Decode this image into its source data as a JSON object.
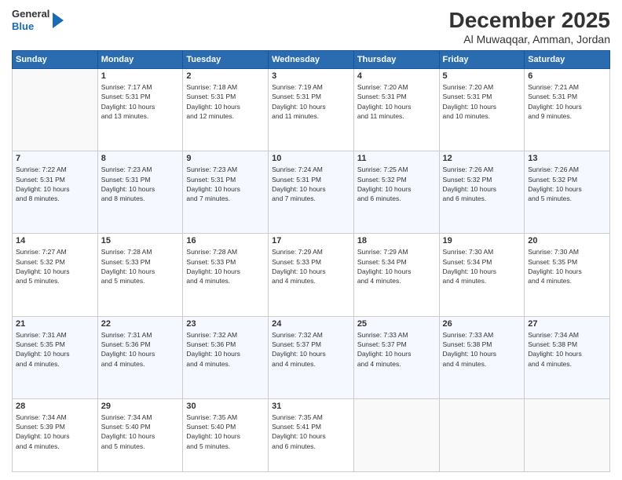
{
  "logo": {
    "general": "General",
    "blue": "Blue"
  },
  "title": "December 2025",
  "subtitle": "Al Muwaqqar, Amman, Jordan",
  "days_header": [
    "Sunday",
    "Monday",
    "Tuesday",
    "Wednesday",
    "Thursday",
    "Friday",
    "Saturday"
  ],
  "weeks": [
    [
      {
        "num": "",
        "info": ""
      },
      {
        "num": "1",
        "info": "Sunrise: 7:17 AM\nSunset: 5:31 PM\nDaylight: 10 hours\nand 13 minutes."
      },
      {
        "num": "2",
        "info": "Sunrise: 7:18 AM\nSunset: 5:31 PM\nDaylight: 10 hours\nand 12 minutes."
      },
      {
        "num": "3",
        "info": "Sunrise: 7:19 AM\nSunset: 5:31 PM\nDaylight: 10 hours\nand 11 minutes."
      },
      {
        "num": "4",
        "info": "Sunrise: 7:20 AM\nSunset: 5:31 PM\nDaylight: 10 hours\nand 11 minutes."
      },
      {
        "num": "5",
        "info": "Sunrise: 7:20 AM\nSunset: 5:31 PM\nDaylight: 10 hours\nand 10 minutes."
      },
      {
        "num": "6",
        "info": "Sunrise: 7:21 AM\nSunset: 5:31 PM\nDaylight: 10 hours\nand 9 minutes."
      }
    ],
    [
      {
        "num": "7",
        "info": "Sunrise: 7:22 AM\nSunset: 5:31 PM\nDaylight: 10 hours\nand 8 minutes."
      },
      {
        "num": "8",
        "info": "Sunrise: 7:23 AM\nSunset: 5:31 PM\nDaylight: 10 hours\nand 8 minutes."
      },
      {
        "num": "9",
        "info": "Sunrise: 7:23 AM\nSunset: 5:31 PM\nDaylight: 10 hours\nand 7 minutes."
      },
      {
        "num": "10",
        "info": "Sunrise: 7:24 AM\nSunset: 5:31 PM\nDaylight: 10 hours\nand 7 minutes."
      },
      {
        "num": "11",
        "info": "Sunrise: 7:25 AM\nSunset: 5:32 PM\nDaylight: 10 hours\nand 6 minutes."
      },
      {
        "num": "12",
        "info": "Sunrise: 7:26 AM\nSunset: 5:32 PM\nDaylight: 10 hours\nand 6 minutes."
      },
      {
        "num": "13",
        "info": "Sunrise: 7:26 AM\nSunset: 5:32 PM\nDaylight: 10 hours\nand 5 minutes."
      }
    ],
    [
      {
        "num": "14",
        "info": "Sunrise: 7:27 AM\nSunset: 5:32 PM\nDaylight: 10 hours\nand 5 minutes."
      },
      {
        "num": "15",
        "info": "Sunrise: 7:28 AM\nSunset: 5:33 PM\nDaylight: 10 hours\nand 5 minutes."
      },
      {
        "num": "16",
        "info": "Sunrise: 7:28 AM\nSunset: 5:33 PM\nDaylight: 10 hours\nand 4 minutes."
      },
      {
        "num": "17",
        "info": "Sunrise: 7:29 AM\nSunset: 5:33 PM\nDaylight: 10 hours\nand 4 minutes."
      },
      {
        "num": "18",
        "info": "Sunrise: 7:29 AM\nSunset: 5:34 PM\nDaylight: 10 hours\nand 4 minutes."
      },
      {
        "num": "19",
        "info": "Sunrise: 7:30 AM\nSunset: 5:34 PM\nDaylight: 10 hours\nand 4 minutes."
      },
      {
        "num": "20",
        "info": "Sunrise: 7:30 AM\nSunset: 5:35 PM\nDaylight: 10 hours\nand 4 minutes."
      }
    ],
    [
      {
        "num": "21",
        "info": "Sunrise: 7:31 AM\nSunset: 5:35 PM\nDaylight: 10 hours\nand 4 minutes."
      },
      {
        "num": "22",
        "info": "Sunrise: 7:31 AM\nSunset: 5:36 PM\nDaylight: 10 hours\nand 4 minutes."
      },
      {
        "num": "23",
        "info": "Sunrise: 7:32 AM\nSunset: 5:36 PM\nDaylight: 10 hours\nand 4 minutes."
      },
      {
        "num": "24",
        "info": "Sunrise: 7:32 AM\nSunset: 5:37 PM\nDaylight: 10 hours\nand 4 minutes."
      },
      {
        "num": "25",
        "info": "Sunrise: 7:33 AM\nSunset: 5:37 PM\nDaylight: 10 hours\nand 4 minutes."
      },
      {
        "num": "26",
        "info": "Sunrise: 7:33 AM\nSunset: 5:38 PM\nDaylight: 10 hours\nand 4 minutes."
      },
      {
        "num": "27",
        "info": "Sunrise: 7:34 AM\nSunset: 5:38 PM\nDaylight: 10 hours\nand 4 minutes."
      }
    ],
    [
      {
        "num": "28",
        "info": "Sunrise: 7:34 AM\nSunset: 5:39 PM\nDaylight: 10 hours\nand 4 minutes."
      },
      {
        "num": "29",
        "info": "Sunrise: 7:34 AM\nSunset: 5:40 PM\nDaylight: 10 hours\nand 5 minutes."
      },
      {
        "num": "30",
        "info": "Sunrise: 7:35 AM\nSunset: 5:40 PM\nDaylight: 10 hours\nand 5 minutes."
      },
      {
        "num": "31",
        "info": "Sunrise: 7:35 AM\nSunset: 5:41 PM\nDaylight: 10 hours\nand 6 minutes."
      },
      {
        "num": "",
        "info": ""
      },
      {
        "num": "",
        "info": ""
      },
      {
        "num": "",
        "info": ""
      }
    ]
  ]
}
